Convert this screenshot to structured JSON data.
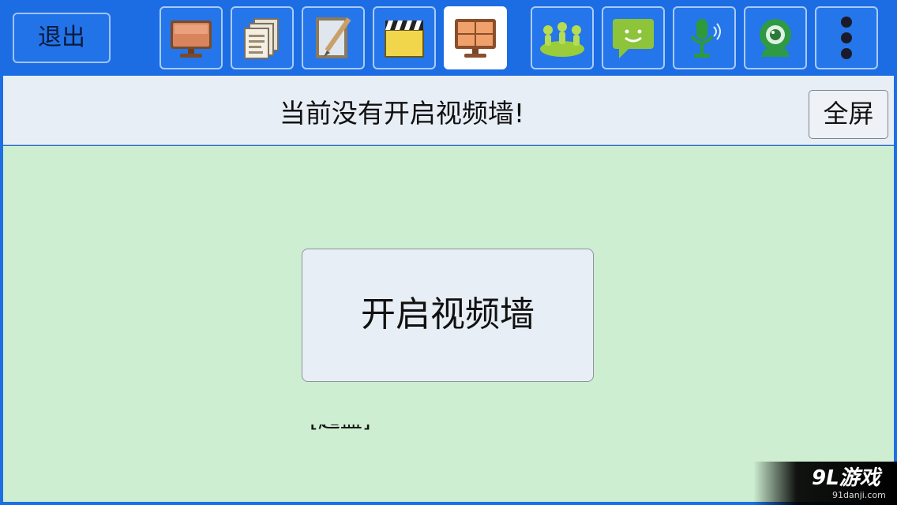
{
  "toolbar": {
    "exit_label": "退出",
    "tools": [
      {
        "icon": "monitor-icon"
      },
      {
        "icon": "documents-icon"
      },
      {
        "icon": "notepad-pen-icon"
      },
      {
        "icon": "clapperboard-icon"
      },
      {
        "icon": "video-wall-icon",
        "active": true
      },
      {
        "icon": "users-group-icon"
      },
      {
        "icon": "chat-bubble-icon"
      },
      {
        "icon": "microphone-icon"
      },
      {
        "icon": "webcam-icon"
      },
      {
        "icon": "more-vertical-icon"
      }
    ]
  },
  "status": {
    "message": "当前没有开启视频墙!",
    "fullscreen_label": "全屏"
  },
  "main": {
    "start_button_label": "开启视频墙",
    "cut_text": "[起盟]"
  },
  "watermark": {
    "logo": "9L游戏",
    "site": "91danji.com"
  },
  "colors": {
    "toolbar_bg": "#1c6de4",
    "status_bg": "#e8eef6",
    "main_bg": "#cdeed1",
    "active_tool_bg": "#ffffff"
  }
}
